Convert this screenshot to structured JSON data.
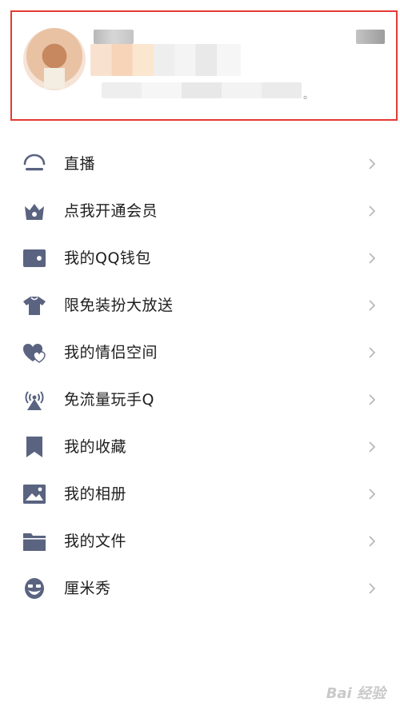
{
  "profile": {
    "signature_end": "。"
  },
  "menu": {
    "items": [
      {
        "label": "直播",
        "icon": "live-icon"
      },
      {
        "label": "点我开通会员",
        "icon": "vip-crown-icon"
      },
      {
        "label": "我的QQ钱包",
        "icon": "wallet-icon"
      },
      {
        "label": "限免装扮大放送",
        "icon": "tshirt-icon"
      },
      {
        "label": "我的情侣空间",
        "icon": "couple-heart-icon"
      },
      {
        "label": "免流量玩手Q",
        "icon": "signal-tower-icon"
      },
      {
        "label": "我的收藏",
        "icon": "bookmark-icon"
      },
      {
        "label": "我的相册",
        "icon": "photo-icon"
      },
      {
        "label": "我的文件",
        "icon": "folder-icon"
      },
      {
        "label": "厘米秀",
        "icon": "cmshow-face-icon"
      }
    ]
  },
  "colors": {
    "icon": "#5a6380",
    "chevron": "#b5b5b5",
    "highlight_border": "#e53935"
  },
  "watermark": "Bai 经验"
}
